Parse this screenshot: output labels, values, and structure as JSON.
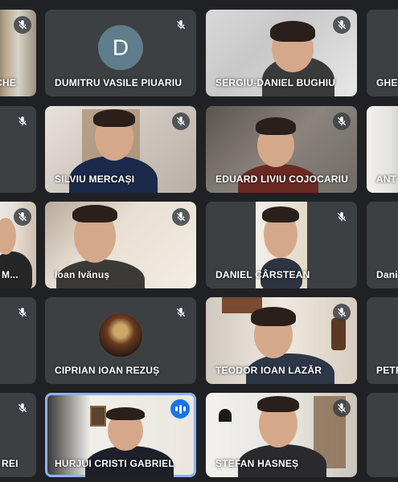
{
  "participants": [
    {
      "name": "CHE",
      "muted": true
    },
    {
      "name": "DUMITRU VASILE PIUARIU",
      "muted": true,
      "avatar_letter": "D"
    },
    {
      "name": "SERGIU-DANIEL BUGHIU",
      "muted": true
    },
    {
      "name": "GHE",
      "muted": false
    },
    {
      "name": "",
      "muted": true
    },
    {
      "name": "SILVIU MERCAȘI",
      "muted": true
    },
    {
      "name": "EDUARD LIVIU COJOCARIU",
      "muted": true
    },
    {
      "name": "ANT",
      "muted": false
    },
    {
      "name": "M...",
      "muted": true
    },
    {
      "name": "Ioan Ivănuș",
      "muted": true
    },
    {
      "name": "DANIEL CÂRSTEAN",
      "muted": true
    },
    {
      "name": "Dani",
      "muted": false
    },
    {
      "name": "",
      "muted": true
    },
    {
      "name": "CIPRIAN IOAN REZUȘ",
      "muted": true
    },
    {
      "name": "TEODOR IOAN LAZĂR",
      "muted": true
    },
    {
      "name": "PETR",
      "muted": false
    },
    {
      "name": "REI",
      "muted": true
    },
    {
      "name": "HURJUI CRISTI GABRIEL",
      "muted": false,
      "speaking": true
    },
    {
      "name": "ȘTEFAN HASNEȘ",
      "muted": true
    },
    {
      "name": "",
      "muted": false
    }
  ],
  "colors": {
    "accent": "#1a73e8",
    "active_border": "#8ab4f8",
    "tile": "#3c4043",
    "bg": "#202124"
  }
}
